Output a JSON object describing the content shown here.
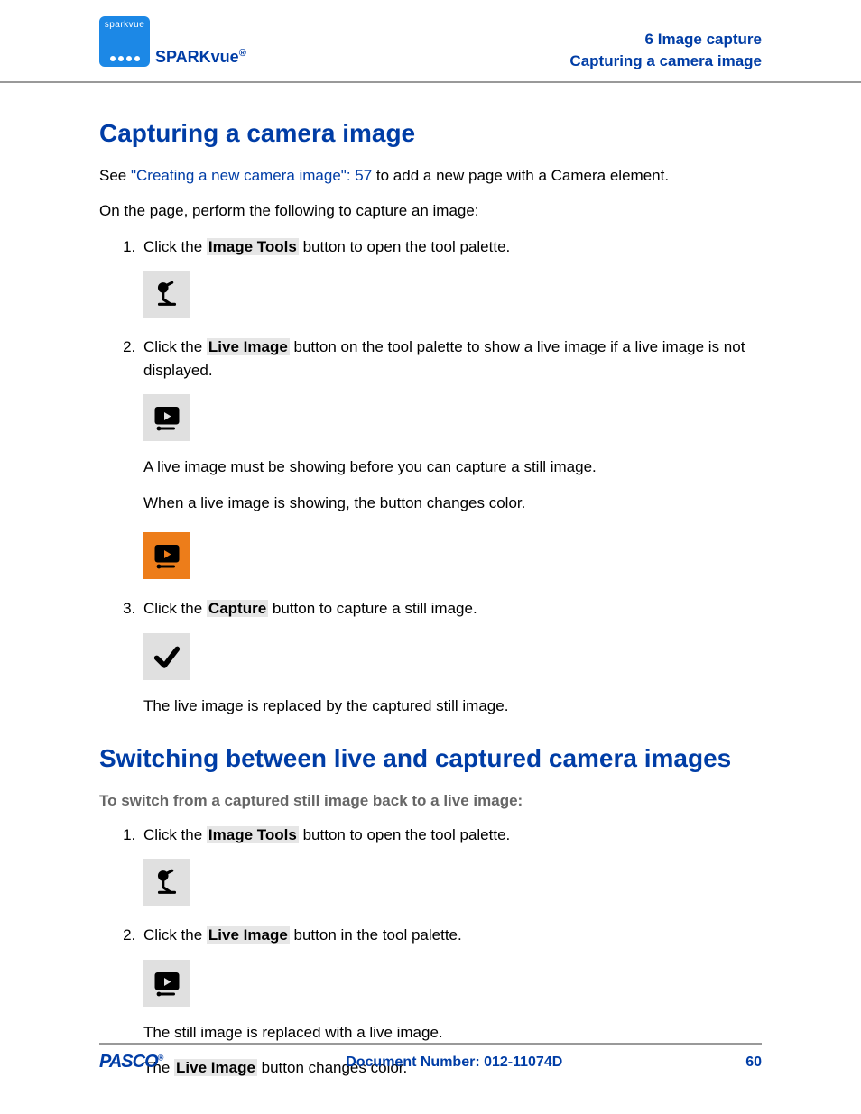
{
  "header": {
    "logo_text": "sparkvue",
    "product_name": "SPARKvue",
    "product_reg": "®",
    "chapter_line": "6   Image capture",
    "topic_line": "Capturing a camera image"
  },
  "section1": {
    "title": "Capturing a camera image",
    "intro_see": "See ",
    "intro_link": "\"Creating a new camera image\":  57",
    "intro_rest": " to add a new page with a Camera element.",
    "intro2": "On the page, perform the following to capture an image:",
    "step1_a": "Click the ",
    "step1_bold": "Image Tools",
    "step1_b": " button to open the tool palette.",
    "step2_a": "Click the ",
    "step2_bold": "Live Image",
    "step2_b": " button on the tool palette to show a live image if a live image is not displayed.",
    "step2_note1": "A live image must be showing before you can capture a still image.",
    "step2_note2": "When a live image is showing, the button changes color.",
    "step3_a": "Click the ",
    "step3_bold": "Capture",
    "step3_b": " button to capture a still image.",
    "step3_note": "The live image is replaced by the captured still image."
  },
  "section2": {
    "title": "Switching between live and captured camera images",
    "sub": "To switch from a captured still image back to a live image:",
    "step1_a": "Click the ",
    "step1_bold": "Image Tools",
    "step1_b": " button to open the tool palette.",
    "step2_a": "Click the ",
    "step2_bold": "Live Image",
    "step2_b": " button in the tool palette.",
    "step2_note1": "The still image is replaced with a live image.",
    "step2_note2a": "The ",
    "step2_note2_bold": "Live Image",
    "step2_note2b": " button changes color."
  },
  "footer": {
    "brand": "PASCO",
    "reg": "®",
    "doc": "Document Number: 012-11074D",
    "page": "60"
  }
}
